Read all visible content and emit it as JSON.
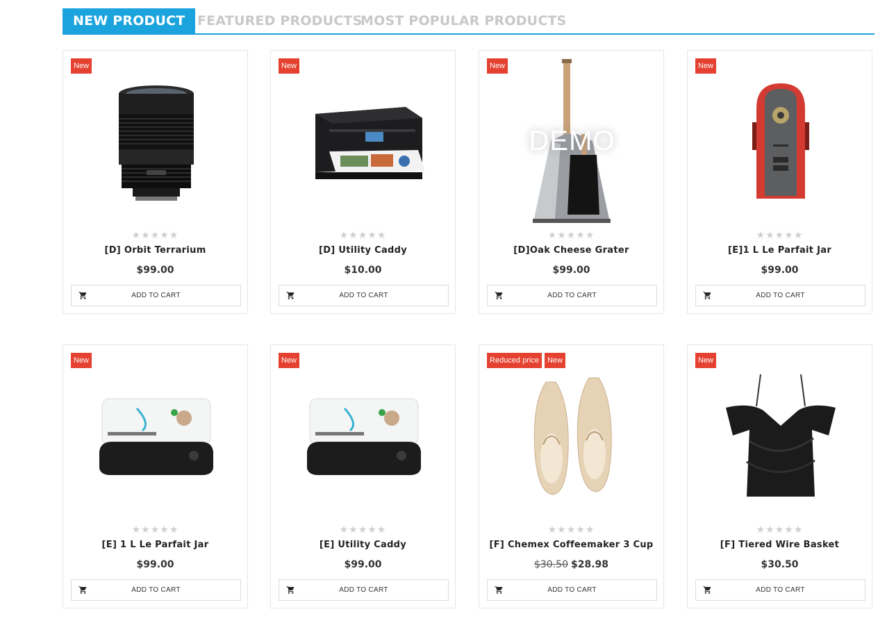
{
  "tabs": [
    {
      "label": "NEW PRODUCT"
    },
    {
      "label": "FEATURED PRODUCTS"
    },
    {
      "label": "MOST POPULAR PRODUCTS"
    }
  ],
  "rating_stars": "★★★★★",
  "cart_label": "ADD TO CART",
  "colors": {
    "accent": "#1aa3dd",
    "badge": "#e54130"
  },
  "products": [
    {
      "badges": [
        "New"
      ],
      "name": "[D] Orbit Terrarium",
      "price": "$99.00",
      "old_price": "",
      "image": "camera-lens"
    },
    {
      "badges": [
        "New"
      ],
      "name": "[D] Utility Caddy",
      "price": "$10.00",
      "old_price": "",
      "image": "printer"
    },
    {
      "badges": [
        "New"
      ],
      "name": "[D]Oak Cheese Grater",
      "price": "$99.00",
      "old_price": "",
      "image": "dustpan-brush",
      "watermark": "DEMO"
    },
    {
      "badges": [
        "New"
      ],
      "name": "[E]1 L Le Parfait Jar",
      "price": "$99.00",
      "old_price": "",
      "image": "red-speaker"
    },
    {
      "badges": [
        "New"
      ],
      "name": "[E] 1 L Le Parfait Jar",
      "price": "$99.00",
      "old_price": "",
      "image": "navdy-device"
    },
    {
      "badges": [
        "New"
      ],
      "name": "[E] Utility Caddy",
      "price": "$99.00",
      "old_price": "",
      "image": "navdy-device"
    },
    {
      "badges": [
        "Reduced price",
        "New"
      ],
      "name": "[F] Chemex Coffeemaker 3 Cup",
      "price": "$28.98",
      "old_price": "$30.50",
      "image": "ballet-flats"
    },
    {
      "badges": [
        "New"
      ],
      "name": "[F] Tiered Wire Basket",
      "price": "$30.50",
      "old_price": "",
      "image": "black-top"
    }
  ]
}
